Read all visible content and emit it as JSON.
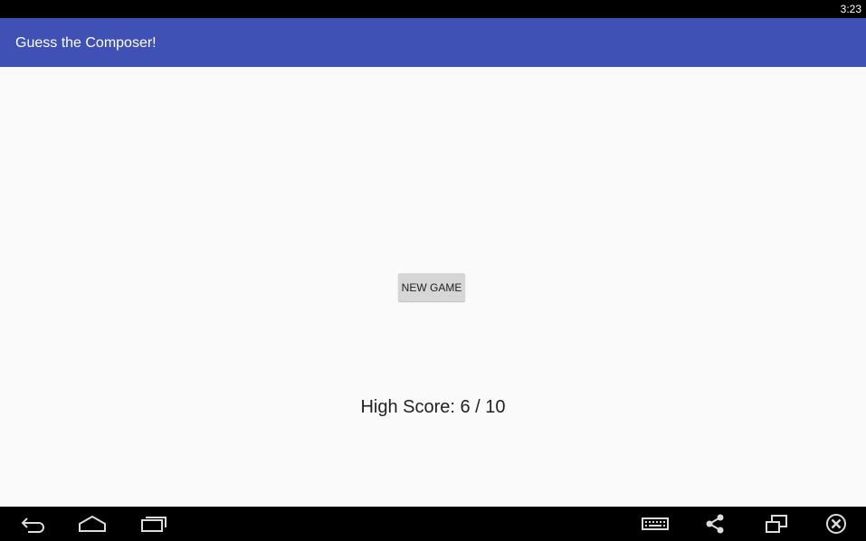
{
  "status_bar": {
    "time": "3:23"
  },
  "app_bar": {
    "title": "Guess the Composer!",
    "color": "#3f51b5"
  },
  "main": {
    "new_game_label": "NEW GAME",
    "high_score_text": "High Score: 6 / 10"
  },
  "nav_bar": {
    "left_buttons": [
      "back-icon",
      "home-icon",
      "recent-apps-icon"
    ],
    "right_buttons": [
      "keyboard-icon",
      "share-icon",
      "rotate-screen-icon",
      "close-icon"
    ]
  }
}
